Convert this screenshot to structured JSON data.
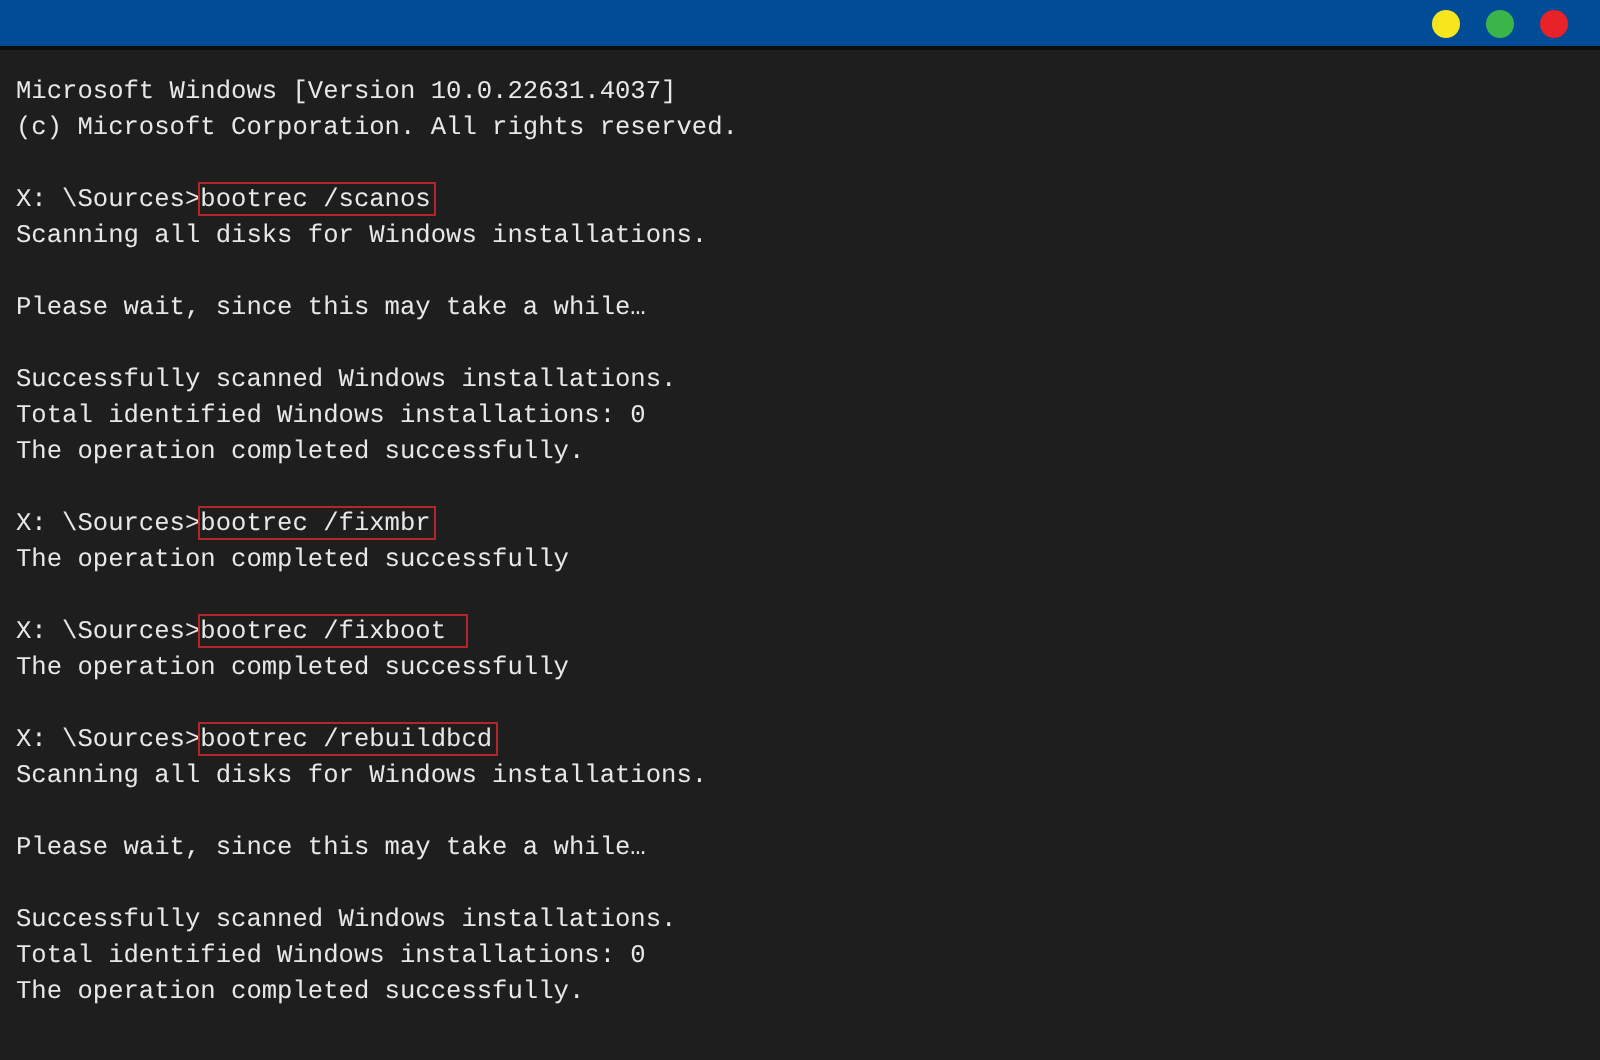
{
  "title_bar": {
    "buttons": [
      {
        "color": "#f7e51e"
      },
      {
        "color": "#3ab54a"
      },
      {
        "color": "#e92129"
      }
    ]
  },
  "console": {
    "lines": [
      {
        "kind": "text",
        "text": "Microsoft Windows [Version 10.0.22631.4037]"
      },
      {
        "kind": "text",
        "text": "(c) Microsoft Corporation. All rights reserved."
      },
      {
        "kind": "blank"
      },
      {
        "kind": "prompt",
        "prompt": "X: \\Sources>",
        "command": "bootrec /scanos"
      },
      {
        "kind": "text",
        "text": "Scanning all disks for Windows installations."
      },
      {
        "kind": "blank"
      },
      {
        "kind": "text",
        "text": "Please wait, since this may take a while…"
      },
      {
        "kind": "blank"
      },
      {
        "kind": "text",
        "text": "Successfully scanned Windows installations."
      },
      {
        "kind": "text",
        "text": "Total identified Windows installations: 0"
      },
      {
        "kind": "text",
        "text": "The operation completed successfully."
      },
      {
        "kind": "blank"
      },
      {
        "kind": "prompt",
        "prompt": "X: \\Sources>",
        "command": "bootrec /fixmbr"
      },
      {
        "kind": "text",
        "text": "The operation completed successfully"
      },
      {
        "kind": "blank"
      },
      {
        "kind": "prompt",
        "prompt": "X: \\Sources>",
        "command": "bootrec /fixboot "
      },
      {
        "kind": "text",
        "text": "The operation completed successfully"
      },
      {
        "kind": "blank"
      },
      {
        "kind": "prompt",
        "prompt": "X: \\Sources>",
        "command": "bootrec /rebuildbcd"
      },
      {
        "kind": "text",
        "text": "Scanning all disks for Windows installations."
      },
      {
        "kind": "blank"
      },
      {
        "kind": "text",
        "text": "Please wait, since this may take a while…"
      },
      {
        "kind": "blank"
      },
      {
        "kind": "text",
        "text": "Successfully scanned Windows installations."
      },
      {
        "kind": "text",
        "text": "Total identified Windows installations: 0"
      },
      {
        "kind": "text",
        "text": "The operation completed successfully."
      }
    ]
  }
}
